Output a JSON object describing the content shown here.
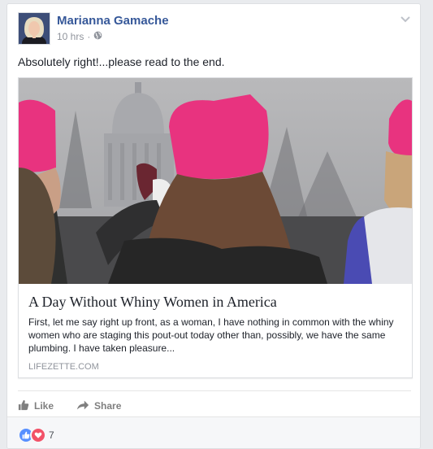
{
  "post": {
    "author": "Marianna Gamache",
    "timestamp": "10 hrs",
    "separator": "·",
    "privacy_icon": "globe-icon",
    "text": "Absolutely right!...please read to the end."
  },
  "link_preview": {
    "title": "A Day Without Whiny Women in America",
    "description": "First, let me say right up front, as a woman, I have nothing in common with the whiny women who are staging this pout-out today other than, possibly, we have the same plumbing. I have taken pleasure...",
    "domain": "LIFEZETTE.COM"
  },
  "actions": {
    "like_label": "Like",
    "share_label": "Share"
  },
  "reactions": {
    "types": [
      "like",
      "love"
    ],
    "count": "7"
  },
  "colors": {
    "author": "#365899",
    "like_blue": "#5890ff",
    "love_red": "#f25268",
    "hat_pink": "#e8337f"
  }
}
